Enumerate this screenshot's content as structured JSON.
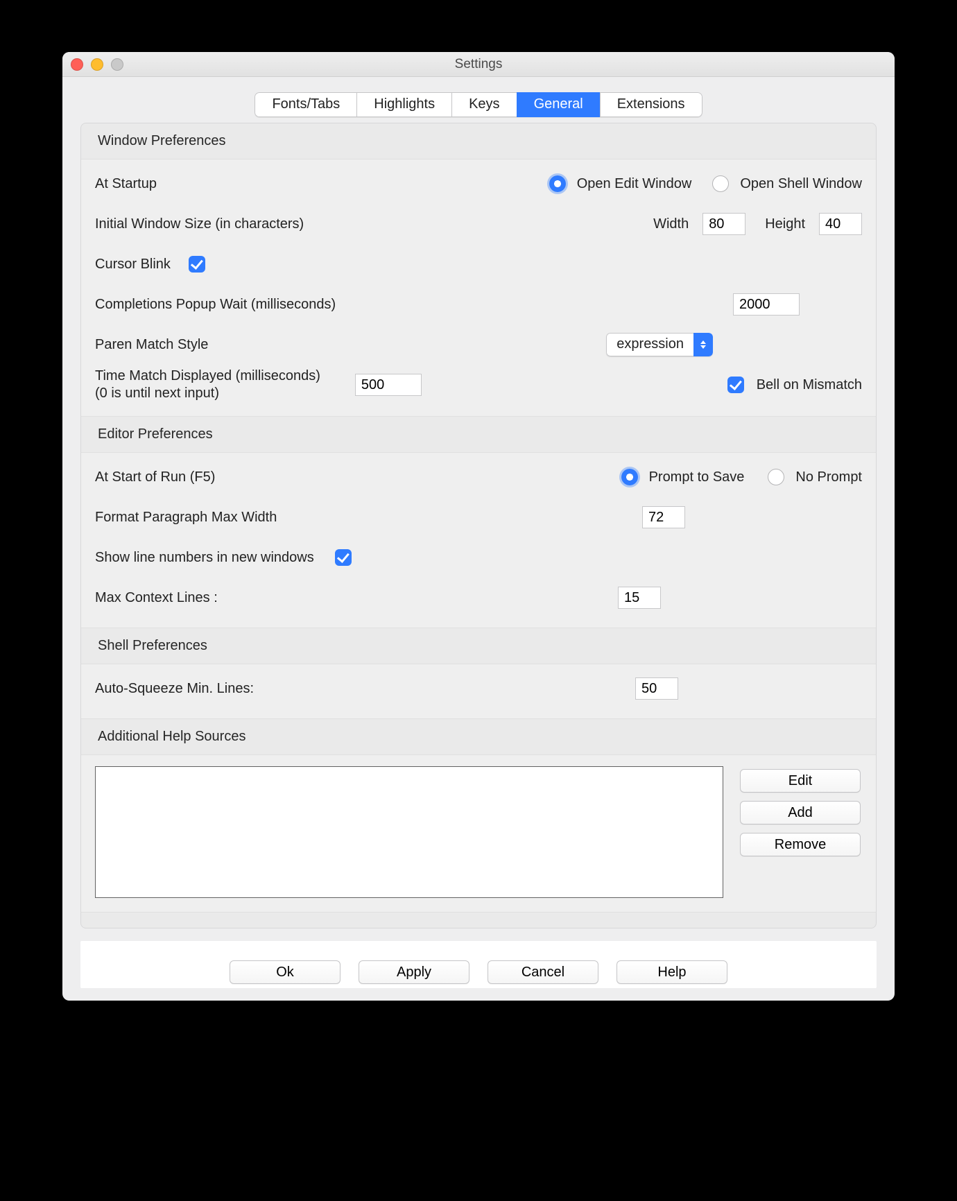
{
  "window": {
    "title": "Settings"
  },
  "traffic": {
    "close": "close",
    "min": "minimize",
    "max": "maximize"
  },
  "tabs": {
    "fonts": "Fonts/Tabs",
    "highlights": "Highlights",
    "keys": "Keys",
    "general": "General",
    "extensions": "Extensions",
    "active": "general"
  },
  "windowPrefs": {
    "title": "Window Preferences",
    "atStartup": {
      "label": "At Startup",
      "openEdit": "Open Edit Window",
      "openShell": "Open Shell Window",
      "selected": "openEdit"
    },
    "initialSize": {
      "label": "Initial Window Size  (in characters)",
      "widthLabel": "Width",
      "width": "80",
      "heightLabel": "Height",
      "height": "40"
    },
    "cursorBlink": {
      "label": "Cursor Blink",
      "checked": true
    },
    "completions": {
      "label": "Completions Popup Wait (milliseconds)",
      "value": "2000"
    },
    "parenMatch": {
      "label": "Paren Match Style",
      "value": "expression"
    },
    "timeMatch": {
      "label1": "Time Match Displayed (milliseconds)",
      "label2": "(0 is until next input)",
      "value": "500",
      "bell": {
        "label": "Bell on Mismatch",
        "checked": true
      }
    }
  },
  "editorPrefs": {
    "title": "Editor Preferences",
    "startRun": {
      "label": "At Start of Run (F5)",
      "prompt": "Prompt to Save",
      "noprompt": "No Prompt",
      "selected": "prompt"
    },
    "paraWidth": {
      "label": "Format Paragraph Max Width",
      "value": "72"
    },
    "lineNumbers": {
      "label": "Show line numbers in new windows",
      "checked": true
    },
    "maxContext": {
      "label": "Max Context Lines :",
      "value": "15"
    }
  },
  "shellPrefs": {
    "title": "Shell Preferences",
    "autoSqueeze": {
      "label": "Auto-Squeeze Min. Lines:",
      "value": "50"
    }
  },
  "helpSources": {
    "title": "Additional Help Sources",
    "buttons": {
      "edit": "Edit",
      "add": "Add",
      "remove": "Remove"
    }
  },
  "bottom": {
    "ok": "Ok",
    "apply": "Apply",
    "cancel": "Cancel",
    "help": "Help"
  }
}
